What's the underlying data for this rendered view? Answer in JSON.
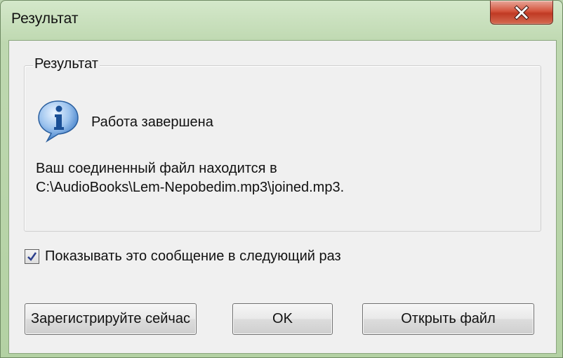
{
  "window": {
    "title": "Результат",
    "close_icon": "close-x-icon"
  },
  "group": {
    "title": "Результат",
    "icon": "info-icon",
    "status": "Работа завершена",
    "message_line1": "Ваш соединенный файл находится в",
    "message_line2": "C:\\AudioBooks\\Lem-Nepobedim.mp3\\joined.mp3."
  },
  "checkbox": {
    "label": "Показывать это сообщение в следующий раз",
    "checked": true
  },
  "buttons": {
    "register": "Зарегистрируйте сейчас",
    "ok": "OK",
    "open_file": "Открыть файл"
  },
  "colors": {
    "titlebar": "#b3d1a3",
    "client": "#f0f0f0",
    "close_button": "#c7402a",
    "info_blue": "#2a6fc0"
  }
}
